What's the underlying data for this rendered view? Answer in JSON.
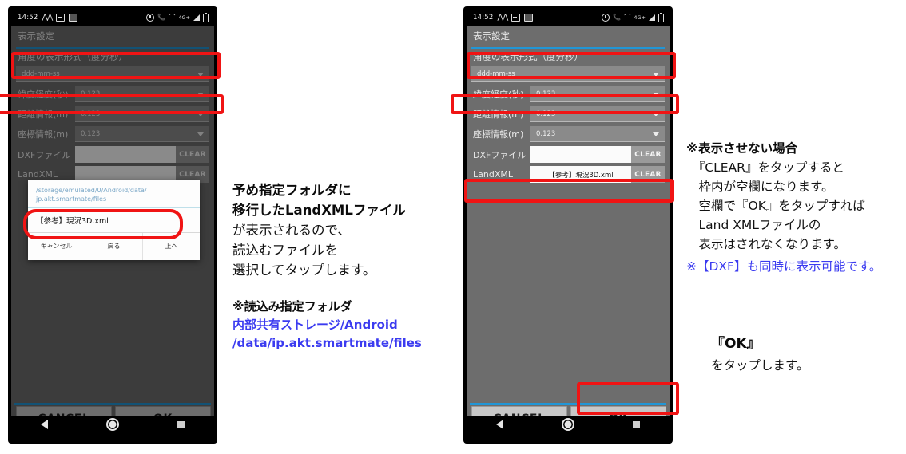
{
  "meta": {
    "accent_blue": "#2196d6",
    "annotation_red": "#f01414",
    "annotation_blue_text": "#3b3bf0"
  },
  "status_bar": {
    "time": "14:52",
    "left_icons": [
      "wave-icon",
      "screenshot-icon",
      "photo-icon"
    ],
    "right_icons": [
      "dnd-icon",
      "missed-call-icon",
      "vpn-icon",
      "network-4g-plus-icon",
      "signal-icon",
      "battery-icon"
    ],
    "network_label": "4G+"
  },
  "app": {
    "title": "表示設定",
    "section_heading": "角度の表示形式（度分秒）",
    "angle_format_value": "ddd-mm-ss",
    "rows": [
      {
        "label": "緯度経度(秒)",
        "value": "0.123",
        "type": "spinner"
      },
      {
        "label": "距離情報(m)",
        "value": "0.123",
        "type": "spinner"
      },
      {
        "label": "座標情報(m)",
        "value": "0.123",
        "type": "spinner"
      }
    ],
    "file_rows": [
      {
        "label": "DXFファイル",
        "value": "",
        "button": "CLEAR"
      },
      {
        "label": "LandXML",
        "value": "【参考】現況3D.xml",
        "button": "CLEAR"
      }
    ],
    "buttons": {
      "cancel": "CANCEL",
      "ok": "OK"
    }
  },
  "phone_left": {
    "file_row_label_partial": "LandXML",
    "dialog": {
      "path_line1": "/storage/emulated/0/Android/data/",
      "path_line2": "jp.akt.smartmate/files",
      "items": [
        "【参考】現況3D.xml"
      ],
      "actions": [
        "キャンセル",
        "戻る",
        "上へ"
      ]
    }
  },
  "notes": {
    "middle": {
      "lines": [
        {
          "text": "予め指定フォルダに",
          "style": "bold"
        },
        {
          "text": "移行したLandXMLファイル",
          "style": "bold"
        },
        {
          "text": "が表示されるので、",
          "style": "normal"
        },
        {
          "text": "読込むファイルを",
          "style": "normal"
        },
        {
          "text": "選択してタップします。",
          "style": "normal"
        }
      ],
      "sub_lines": [
        {
          "text": "※読込み指定フォルダ",
          "style": "bold"
        },
        {
          "text": "内部共有ストレージ/Android",
          "style": "blue-bold"
        },
        {
          "text": "/data/ip.akt.smartmate/files",
          "style": "blue-bold"
        }
      ]
    },
    "right_top": {
      "lines": [
        {
          "text": "※表示させない場合",
          "style": "bold"
        },
        {
          "text": "　『CLEAR』をタップすると",
          "style": "mixed-bold-clear"
        },
        {
          "text": "　枠内が空欄になります。",
          "style": "normal"
        },
        {
          "text": "　空欄で『OK』をタップすれば",
          "style": "normal"
        },
        {
          "text": "　Land XMLファイルの",
          "style": "normal"
        },
        {
          "text": "　表示はされなくなります。",
          "style": "normal"
        }
      ],
      "blue_line": "※【DXF】も同時に表示可能です。"
    },
    "right_bottom": {
      "line1": "『OK』",
      "line2": "をタップします。"
    }
  }
}
